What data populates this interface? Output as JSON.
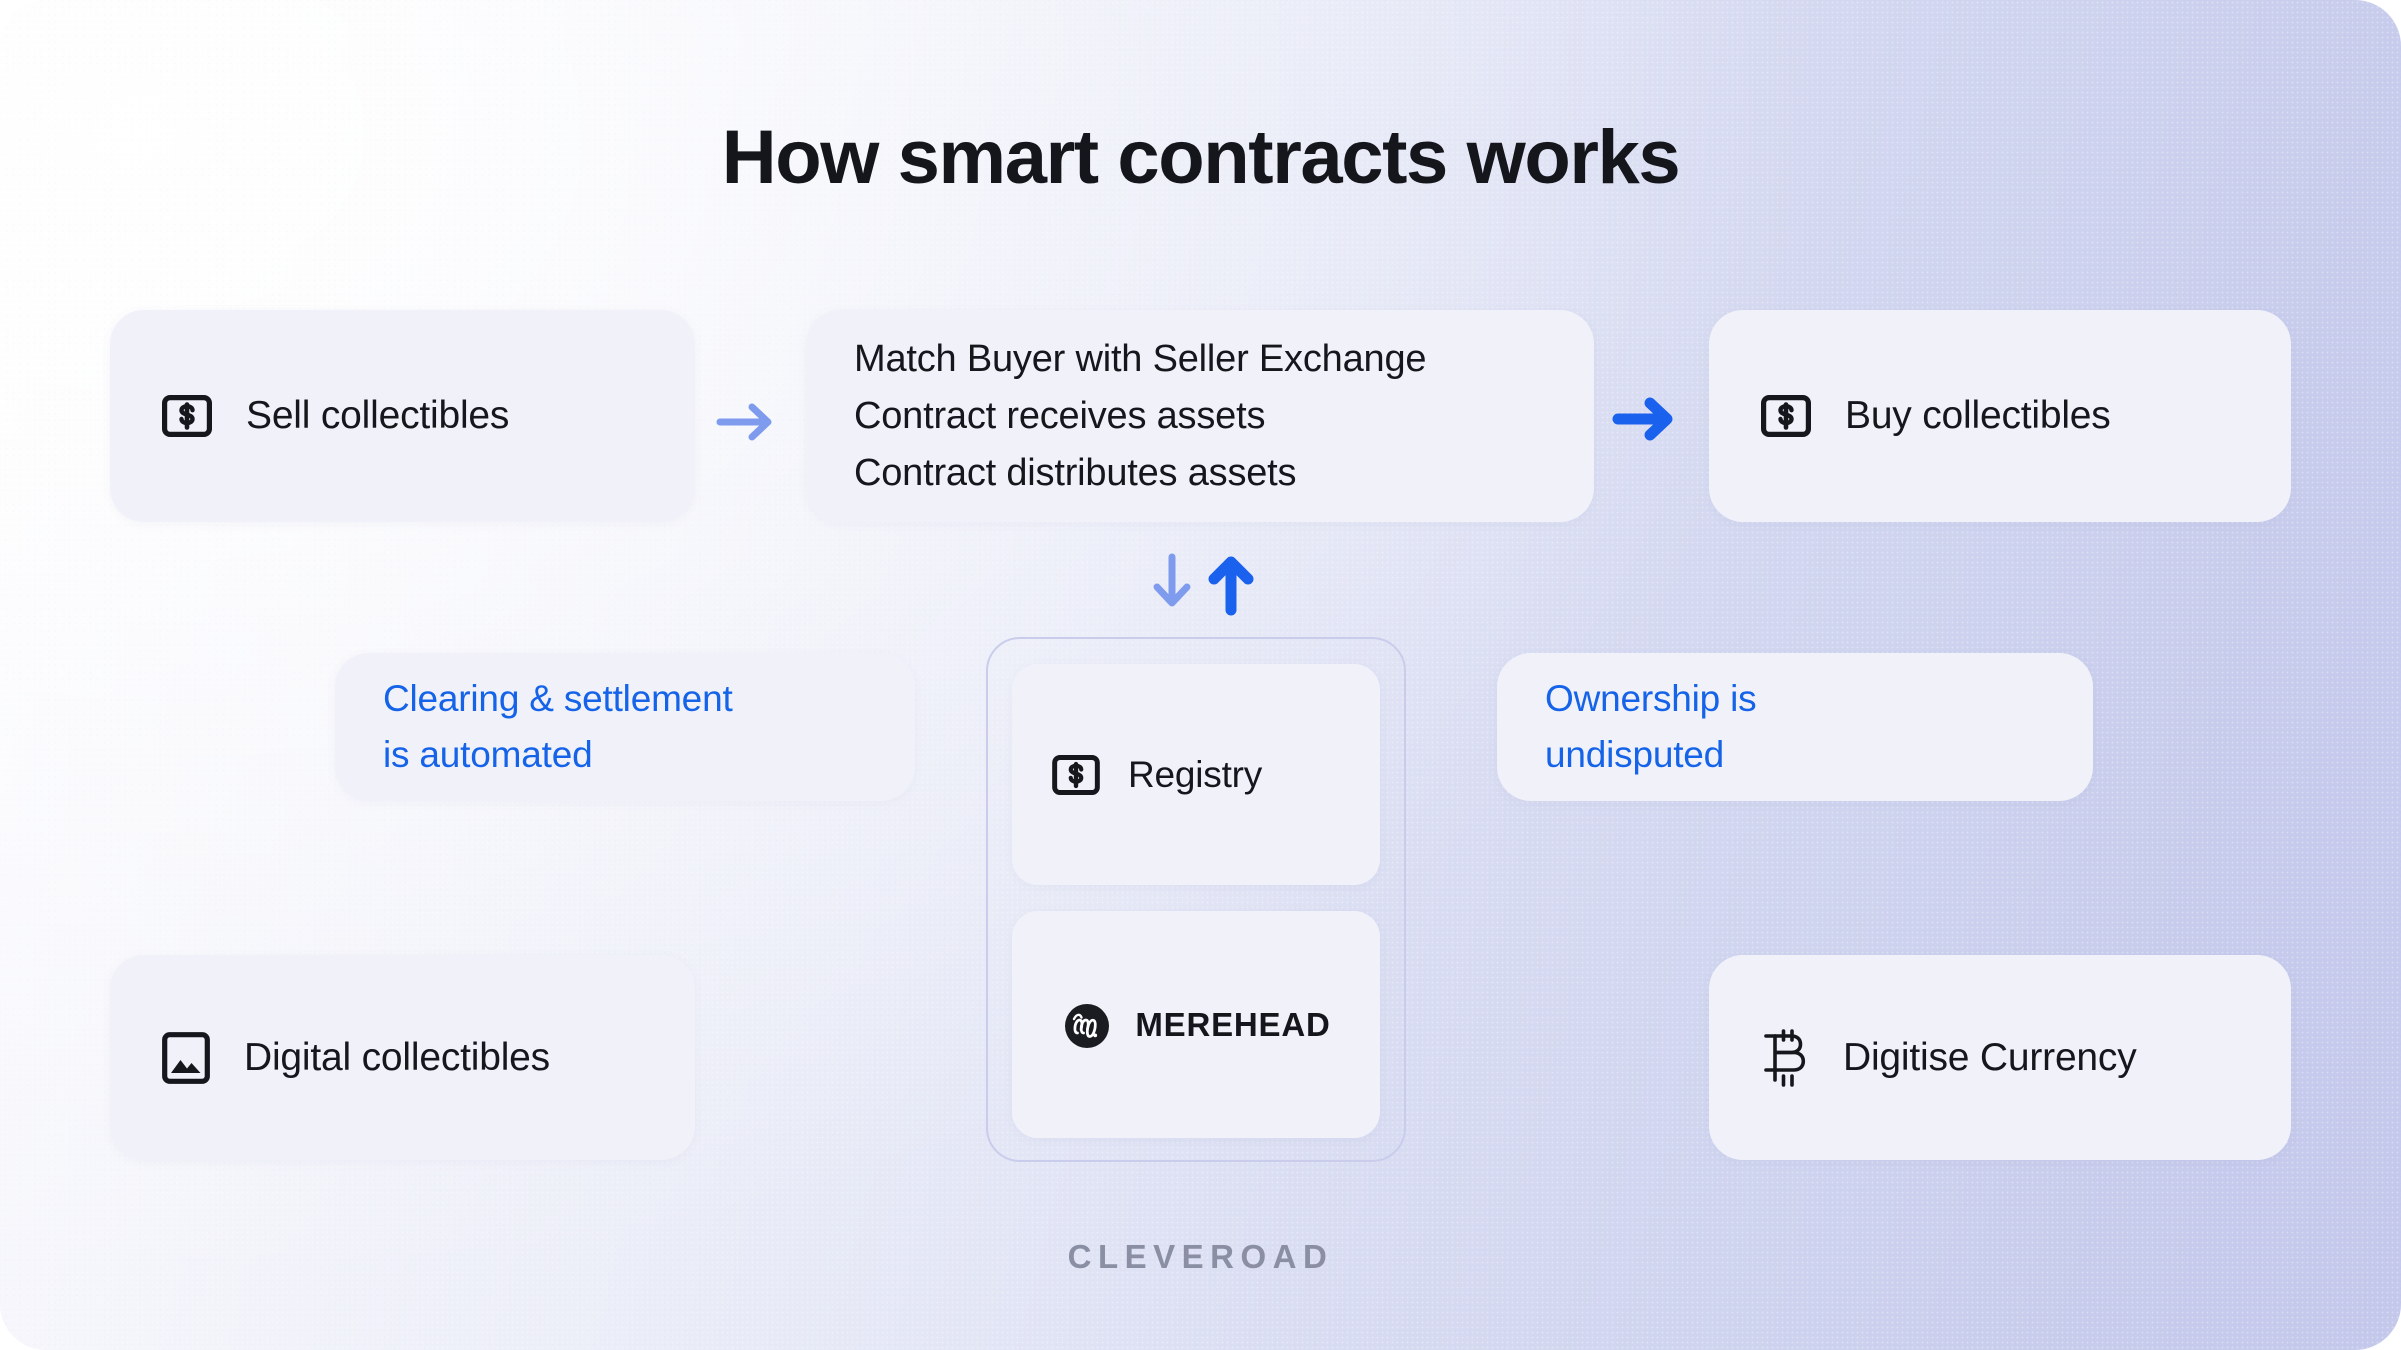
{
  "title": "How smart contracts works",
  "colors": {
    "accent_blue": "#1563E8",
    "arrow_light": "#7E9BEE",
    "card_bg": "#F1F2F9",
    "text_dark": "#16171D",
    "group_border": "#C9CDEB",
    "footer_gray": "#8A8FA3",
    "bg_start": "#FBFBFE",
    "bg_end": "#C4C8EB"
  },
  "row1": {
    "sell": {
      "icon": "banknote-dollar-icon",
      "label": "Sell collectibles"
    },
    "contract": {
      "lines": [
        "Match Buyer with Seller Exchange",
        "Contract receives assets",
        "Contract distributes assets"
      ]
    },
    "buy": {
      "icon": "banknote-dollar-icon",
      "label": "Buy collectibles"
    }
  },
  "arrows": {
    "right_1": "arrow-right-icon",
    "right_2": "arrow-right-icon",
    "down": "arrow-down-icon",
    "up": "arrow-up-icon"
  },
  "row2": {
    "clearing": {
      "lines": [
        "Clearing & settlement",
        "is automated"
      ]
    },
    "ownership": {
      "lines": [
        "Ownership is",
        "undisputed"
      ]
    }
  },
  "registry_group": {
    "registry": {
      "icon": "banknote-dollar-icon",
      "label": "Registry"
    },
    "brand": {
      "icon": "merehead-monogram-icon",
      "label": "MEREHEAD"
    }
  },
  "row3": {
    "digital": {
      "icon": "image-picture-icon",
      "label": "Digital collectibles"
    },
    "currency": {
      "icon": "bitcoin-icon",
      "label": "Digitise Currency"
    }
  },
  "footer": {
    "logo": "CLEVEROAD"
  }
}
